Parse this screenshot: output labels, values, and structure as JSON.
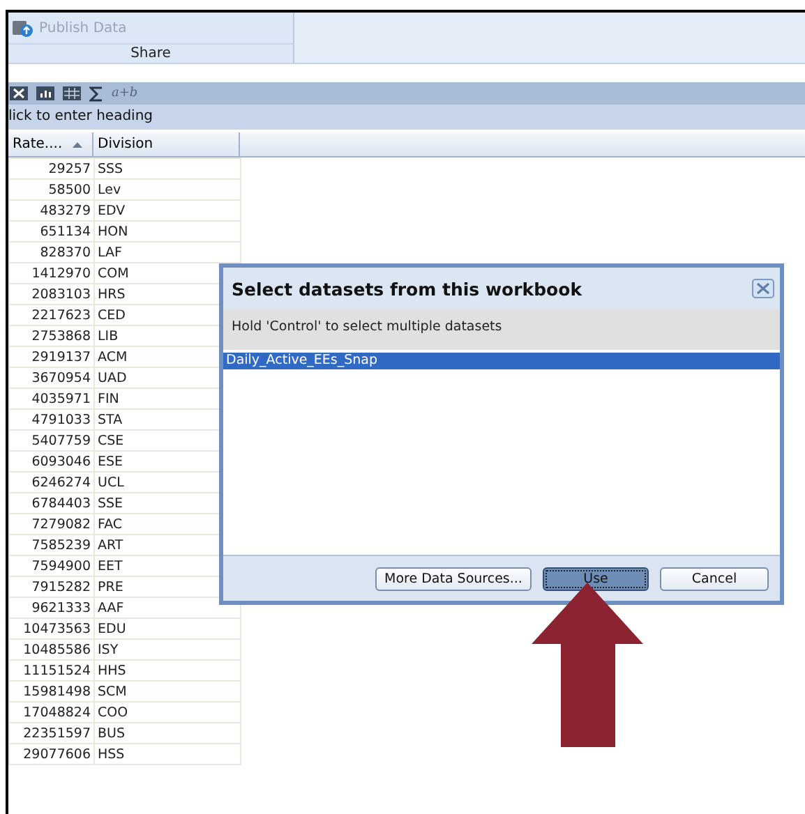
{
  "ribbon": {
    "buttons": [
      {
        "label": "Publish Data",
        "disabled": true
      }
    ],
    "group_label": "Share"
  },
  "toolbar": {
    "formula_label": "a+b"
  },
  "heading": "lick to enter heading",
  "table": {
    "columns": [
      {
        "label": "Rate....",
        "sorted_ascending": true
      },
      {
        "label": "Division",
        "sorted_ascending": false
      }
    ],
    "rows": [
      [
        "29257",
        "SSS"
      ],
      [
        "58500",
        "Lev"
      ],
      [
        "483279",
        "EDV"
      ],
      [
        "651134",
        "HON"
      ],
      [
        "828370",
        "LAF"
      ],
      [
        "1412970",
        "COM"
      ],
      [
        "2083103",
        "HRS"
      ],
      [
        "2217623",
        "CED"
      ],
      [
        "2753868",
        "LIB"
      ],
      [
        "2919137",
        "ACM"
      ],
      [
        "3670954",
        "UAD"
      ],
      [
        "4035971",
        "FIN"
      ],
      [
        "4791033",
        "STA"
      ],
      [
        "5407759",
        "CSE"
      ],
      [
        "6093046",
        "ESE"
      ],
      [
        "6246274",
        "UCL"
      ],
      [
        "6784403",
        "SSE"
      ],
      [
        "7279082",
        "FAC"
      ],
      [
        "7585239",
        "ART"
      ],
      [
        "7594900",
        "EET"
      ],
      [
        "7915282",
        "PRE"
      ],
      [
        "9621333",
        "AAF"
      ],
      [
        "10473563",
        "EDU"
      ],
      [
        "10485586",
        "ISY"
      ],
      [
        "11151524",
        "HHS"
      ],
      [
        "15981498",
        "SCM"
      ],
      [
        "17048824",
        "COO"
      ],
      [
        "22351597",
        "BUS"
      ],
      [
        "29077606",
        "HSS"
      ]
    ]
  },
  "dialog": {
    "title": "Select datasets from this workbook",
    "instructions": "Hold 'Control' to select multiple datasets",
    "datasets": [
      {
        "label": "Daily_Active_EEs_Snap",
        "selected": true
      }
    ],
    "buttons": [
      {
        "label": "More Data Sources...",
        "focused": false
      },
      {
        "label": "Use",
        "focused": true
      },
      {
        "label": "Cancel",
        "focused": false
      }
    ]
  }
}
